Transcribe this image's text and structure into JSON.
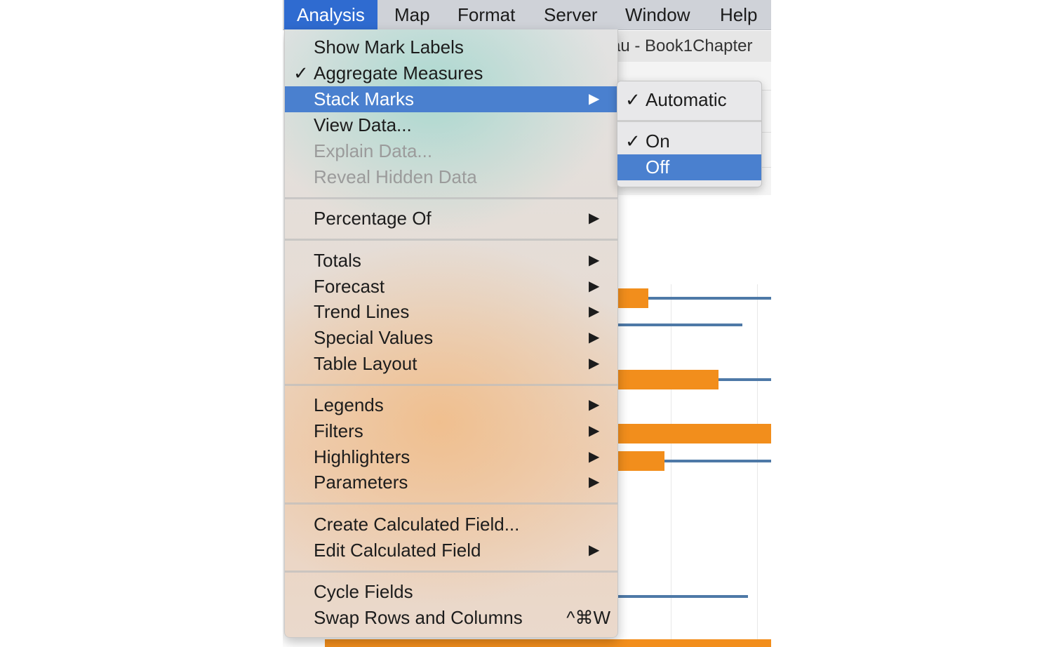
{
  "menubar": {
    "items": [
      {
        "label": "Analysis",
        "active": true
      },
      {
        "label": "Map"
      },
      {
        "label": "Format"
      },
      {
        "label": "Server"
      },
      {
        "label": "Window"
      },
      {
        "label": "Help"
      }
    ]
  },
  "window": {
    "title": "au - Book1Chapter"
  },
  "menu": {
    "show_mark_labels": "Show Mark Labels",
    "aggregate_measures": "Aggregate Measures",
    "stack_marks": "Stack Marks",
    "view_data": "View Data...",
    "explain_data": "Explain Data...",
    "reveal_hidden_data": "Reveal Hidden Data",
    "percentage_of": "Percentage Of",
    "totals": "Totals",
    "forecast": "Forecast",
    "trend_lines": "Trend Lines",
    "special_values": "Special Values",
    "table_layout": "Table Layout",
    "legends": "Legends",
    "filters": "Filters",
    "highlighters": "Highlighters",
    "parameters": "Parameters",
    "create_calculated_field": "Create Calculated Field...",
    "edit_calculated_field": "Edit Calculated Field",
    "cycle_fields": "Cycle Fields",
    "swap_rows_and_columns": "Swap Rows and Columns",
    "swap_shortcut": "^⌘W",
    "checkmark": "✓",
    "arrow": "▶"
  },
  "submenu": {
    "automatic": "Automatic",
    "on": "On",
    "off": "Off",
    "checkmark": "✓"
  },
  "colors": {
    "highlight": "#4a80cf",
    "menubar_active": "#2f6bd0",
    "bar_orange": "#f28e1c",
    "line_blue": "#4e79a7"
  }
}
